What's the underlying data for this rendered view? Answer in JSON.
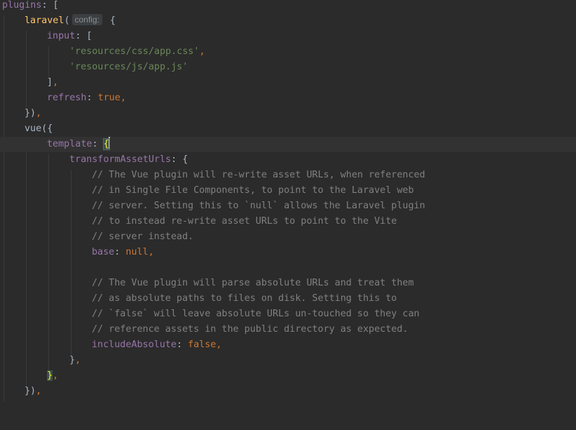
{
  "editor": {
    "lines": {
      "l01": {
        "a": "plugins",
        "b": ": ["
      },
      "l02": {
        "fn": "laravel",
        "open": "(",
        "hint": "config:",
        "brace": " {"
      },
      "l03": {
        "a": "input",
        "b": ": ["
      },
      "l04": {
        "str": "'resources/css/app.css'",
        "comma": ","
      },
      "l05": {
        "str": "'resources/js/app.js'"
      },
      "l06": {
        "a": "]",
        "comma": ","
      },
      "l07": {
        "a": "refresh",
        "b": ": ",
        "kw": "true",
        "comma": ","
      },
      "l08": {
        "a": "})",
        "comma": ","
      },
      "l09": {
        "a": "vue({"
      },
      "l10": {
        "a": "template",
        "b": ": ",
        "brace": "{"
      },
      "l11": {
        "a": "transformAssetUrls",
        "b": ": {"
      },
      "l12": {
        "cmt": "// The Vue plugin will re-write asset URLs, when referenced"
      },
      "l13": {
        "cmt": "// in Single File Components, to point to the Laravel web"
      },
      "l14": {
        "cmt": "// server. Setting this to `null` allows the Laravel plugin"
      },
      "l15": {
        "cmt": "// to instead re-write asset URLs to point to the Vite"
      },
      "l16": {
        "cmt": "// server instead."
      },
      "l17": {
        "a": "base",
        "b": ": ",
        "kw": "null",
        "comma": ","
      },
      "l19": {
        "cmt": "// The Vue plugin will parse absolute URLs and treat them"
      },
      "l20": {
        "cmt": "// as absolute paths to files on disk. Setting this to"
      },
      "l21": {
        "cmt": "// `false` will leave absolute URLs un-touched so they can"
      },
      "l22": {
        "cmt": "// reference assets in the public directory as expected."
      },
      "l23": {
        "a": "includeAbsolute",
        "b": ": ",
        "kw": "false",
        "comma": ","
      },
      "l24": {
        "a": "}",
        "comma": ","
      },
      "l25": {
        "brace": "}",
        "comma": ","
      },
      "l26": {
        "a": "})",
        "comma": ","
      }
    }
  }
}
